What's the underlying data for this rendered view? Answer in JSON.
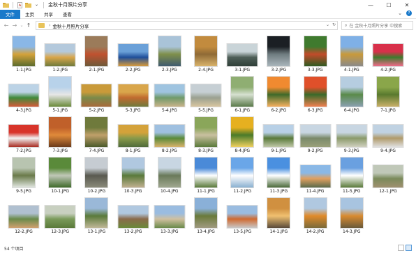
{
  "window": {
    "title": "金秋十月照片分享",
    "controls": {
      "minimize": "—",
      "maximize": "☐",
      "close": "✕"
    }
  },
  "ribbon": {
    "tabs": [
      {
        "label": "文件",
        "active": true
      },
      {
        "label": "主页",
        "active": false
      },
      {
        "label": "共享",
        "active": false
      },
      {
        "label": "查看",
        "active": false
      }
    ],
    "expand": "⌄",
    "help": "?"
  },
  "address": {
    "back": "←",
    "forward": "→",
    "recent": "⌄",
    "up": "↑",
    "sep": "›",
    "path": "金秋十月照片分享",
    "dropdown": "⌄",
    "refresh": "↻"
  },
  "search": {
    "placeholder": "在 金秋十月照片分享 中搜索",
    "icon": "⌕"
  },
  "status": {
    "count": "54 个项目"
  },
  "files": [
    {
      "name": "1-1.JPG",
      "w": 34,
      "h": 45,
      "c": [
        "#8ab7e6",
        "#d4a23a",
        "#5a6b2e"
      ]
    },
    {
      "name": "1-2.JPG",
      "w": 45,
      "h": 34,
      "c": [
        "#b4c9dc",
        "#d9a64b",
        "#6f7a3c"
      ]
    },
    {
      "name": "2-1.JPG",
      "w": 34,
      "h": 45,
      "c": [
        "#9b7b5a",
        "#c0512f",
        "#6d5a3a"
      ]
    },
    {
      "name": "2-2.JPG",
      "w": 45,
      "h": 34,
      "c": [
        "#6aa0d8",
        "#1f4f9a",
        "#d89a3a"
      ]
    },
    {
      "name": "2-3.JPG",
      "w": 34,
      "h": 45,
      "c": [
        "#a9c3d8",
        "#7f8f4a",
        "#3f5a6f"
      ]
    },
    {
      "name": "2-4.JPG",
      "w": 34,
      "h": 45,
      "c": [
        "#c28b3e",
        "#8f6a36",
        "#d9b36b"
      ]
    },
    {
      "name": "3-1.JPG",
      "w": 45,
      "h": 34,
      "c": [
        "#c9d4d8",
        "#4f5f58",
        "#2f3f38"
      ]
    },
    {
      "name": "3-2.JPG",
      "w": 34,
      "h": 45,
      "c": [
        "#1b1f24",
        "#6f7c80",
        "#aab6bc"
      ]
    },
    {
      "name": "3-3.JPG",
      "w": 34,
      "h": 45,
      "c": [
        "#3f7a2e",
        "#c24b2a",
        "#2e5a22"
      ]
    },
    {
      "name": "4-1.JPG",
      "w": 34,
      "h": 45,
      "c": [
        "#7fb0e6",
        "#c99a3a",
        "#8a8a8a"
      ]
    },
    {
      "name": "4-2.JPG",
      "w": 45,
      "h": 34,
      "c": [
        "#d8304a",
        "#3f7a2e",
        "#f06a8a"
      ]
    },
    {
      "name": "4-3.JPG",
      "w": 45,
      "h": 34,
      "c": [
        "#bcd3e6",
        "#3f8a3a",
        "#d45a3a"
      ]
    },
    {
      "name": "5-1.JPG",
      "w": 34,
      "h": 45,
      "c": [
        "#b8d2ea",
        "#e6e6e6",
        "#6a8a3a"
      ]
    },
    {
      "name": "5-2.JPG",
      "w": 45,
      "h": 34,
      "c": [
        "#c99a3a",
        "#7a8a4a",
        "#a86a3a"
      ]
    },
    {
      "name": "5-3.JPG",
      "w": 45,
      "h": 34,
      "c": [
        "#d9a64b",
        "#c06a2f",
        "#6f7a3c"
      ]
    },
    {
      "name": "5-4.JPG",
      "w": 45,
      "h": 34,
      "c": [
        "#9fc4e0",
        "#6f9a6a",
        "#c9b38a"
      ]
    },
    {
      "name": "5-5.JPG",
      "w": 45,
      "h": 34,
      "c": [
        "#c6cfd4",
        "#9aa090",
        "#d8c6a0"
      ]
    },
    {
      "name": "6-1.JPG",
      "w": 34,
      "h": 45,
      "c": [
        "#8fae72",
        "#d6e0d0",
        "#5a7a4a"
      ]
    },
    {
      "name": "6-2.JPG",
      "w": 34,
      "h": 45,
      "c": [
        "#f08a30",
        "#3f6a2a",
        "#f6b060"
      ]
    },
    {
      "name": "6-3.JPG",
      "w": 34,
      "h": 45,
      "c": [
        "#e0502a",
        "#3a6a2a",
        "#f08050"
      ]
    },
    {
      "name": "6-4.JPG",
      "w": 34,
      "h": 45,
      "c": [
        "#b6cde0",
        "#5a8a4a",
        "#8aa0b0"
      ]
    },
    {
      "name": "7-1.JPG",
      "w": 34,
      "h": 45,
      "c": [
        "#8aa64a",
        "#5a7a2e",
        "#c9b06a"
      ]
    },
    {
      "name": "7-2.JPG",
      "w": 45,
      "h": 34,
      "c": [
        "#d8342a",
        "#f2f2f2",
        "#a82a20"
      ]
    },
    {
      "name": "7-3.JPG",
      "w": 34,
      "h": 45,
      "c": [
        "#c0602a",
        "#e08a3a",
        "#6a3a1a"
      ]
    },
    {
      "name": "7-4.JPG",
      "w": 34,
      "h": 45,
      "c": [
        "#6f7a3c",
        "#c0a06a",
        "#4a5a2a"
      ]
    },
    {
      "name": "8-1.JPG",
      "w": 45,
      "h": 34,
      "c": [
        "#d4a23a",
        "#8a9a4a",
        "#4f6a3a"
      ]
    },
    {
      "name": "8-2.JPG",
      "w": 45,
      "h": 34,
      "c": [
        "#9fc0e0",
        "#5a8a3a",
        "#d9b36b"
      ]
    },
    {
      "name": "8-3.JPG",
      "w": 34,
      "h": 45,
      "c": [
        "#8aa65a",
        "#c9c0a0",
        "#5a7a3a"
      ]
    },
    {
      "name": "8-4.JPG",
      "w": 34,
      "h": 45,
      "c": [
        "#e6b020",
        "#4a7a2a",
        "#f0d060"
      ]
    },
    {
      "name": "9-1.JPG",
      "w": 45,
      "h": 34,
      "c": [
        "#b8d0e6",
        "#5a7a3a",
        "#c0c8a8"
      ]
    },
    {
      "name": "9-2.JPG",
      "w": 45,
      "h": 34,
      "c": [
        "#c8d6e2",
        "#7a8a6a",
        "#9aa07a"
      ]
    },
    {
      "name": "9-3.JPG",
      "w": 45,
      "h": 34,
      "c": [
        "#c8d6e2",
        "#8a9a6a",
        "#d0d0c0"
      ]
    },
    {
      "name": "9-4.JPG",
      "w": 45,
      "h": 34,
      "c": [
        "#c0d2e2",
        "#b09a6a",
        "#e0e0e0"
      ]
    },
    {
      "name": "9-5.JPG",
      "w": 34,
      "h": 45,
      "c": [
        "#b8c4b0",
        "#6a7a4a",
        "#e0e6e0"
      ]
    },
    {
      "name": "10-1.JPG",
      "w": 34,
      "h": 45,
      "c": [
        "#5a8a3a",
        "#c0c8b8",
        "#3f6a2a"
      ]
    },
    {
      "name": "10-2.JPG",
      "w": 34,
      "h": 45,
      "c": [
        "#c6ccd2",
        "#5a5a50",
        "#8a8a7a"
      ]
    },
    {
      "name": "10-3.JPG",
      "w": 34,
      "h": 45,
      "c": [
        "#b0c8e0",
        "#5a7a3a",
        "#c0b090"
      ]
    },
    {
      "name": "10-4.JPG",
      "w": 34,
      "h": 45,
      "c": [
        "#c8d6e2",
        "#6a7a5a",
        "#a0a890"
      ]
    },
    {
      "name": "11-1.JPG",
      "w": 34,
      "h": 45,
      "c": [
        "#4a8ad8",
        "#ffffff",
        "#5a7a3a"
      ]
    },
    {
      "name": "11-2.JPG",
      "w": 34,
      "h": 45,
      "c": [
        "#6aa6e8",
        "#ffffff",
        "#8ab0d0"
      ]
    },
    {
      "name": "11-3.JPG",
      "w": 34,
      "h": 45,
      "c": [
        "#4a90e0",
        "#ffffff",
        "#4a6a3a"
      ]
    },
    {
      "name": "11-4.JPG",
      "w": 45,
      "h": 34,
      "c": [
        "#8ab8e6",
        "#e0a060",
        "#5a6a4a"
      ]
    },
    {
      "name": "11-5.JPG",
      "w": 34,
      "h": 45,
      "c": [
        "#6aa0e0",
        "#ffffff",
        "#5a7a3a"
      ]
    },
    {
      "name": "12-1.JPG",
      "w": 45,
      "h": 34,
      "c": [
        "#c0c8b8",
        "#7a8a5a",
        "#a09070"
      ]
    },
    {
      "name": "12-2.JPG",
      "w": 45,
      "h": 34,
      "c": [
        "#b0c0d0",
        "#6a8a4a",
        "#d0a070"
      ]
    },
    {
      "name": "12-3.JPG",
      "w": 45,
      "h": 34,
      "c": [
        "#c8d0c0",
        "#7a9a5a",
        "#5a7a3a"
      ]
    },
    {
      "name": "13-1.JPG",
      "w": 34,
      "h": 45,
      "c": [
        "#9ab8d8",
        "#5a7a3a",
        "#c0b898"
      ]
    },
    {
      "name": "13-2.JPG",
      "w": 45,
      "h": 34,
      "c": [
        "#b0c8e0",
        "#8a6a4a",
        "#6a8a3a"
      ]
    },
    {
      "name": "13-3.JPG",
      "w": 45,
      "h": 34,
      "c": [
        "#9abce0",
        "#d0c0a0",
        "#6a8a4a"
      ]
    },
    {
      "name": "13-4.JPG",
      "w": 34,
      "h": 45,
      "c": [
        "#8ab0d8",
        "#6a7a3a",
        "#a09a80"
      ]
    },
    {
      "name": "13-5.JPG",
      "w": 45,
      "h": 34,
      "c": [
        "#9abce0",
        "#d06a30",
        "#c8c8c8"
      ]
    },
    {
      "name": "14-1.JPG",
      "w": 34,
      "h": 45,
      "c": [
        "#d09040",
        "#f0c070",
        "#5a4a3a"
      ]
    },
    {
      "name": "14-2.JPG",
      "w": 34,
      "h": 45,
      "c": [
        "#b0c8e0",
        "#e08a2a",
        "#7a6a3a"
      ]
    },
    {
      "name": "14-3.JPG",
      "w": 34,
      "h": 45,
      "c": [
        "#a8c4e0",
        "#d88a30",
        "#6a5a3a"
      ]
    }
  ]
}
